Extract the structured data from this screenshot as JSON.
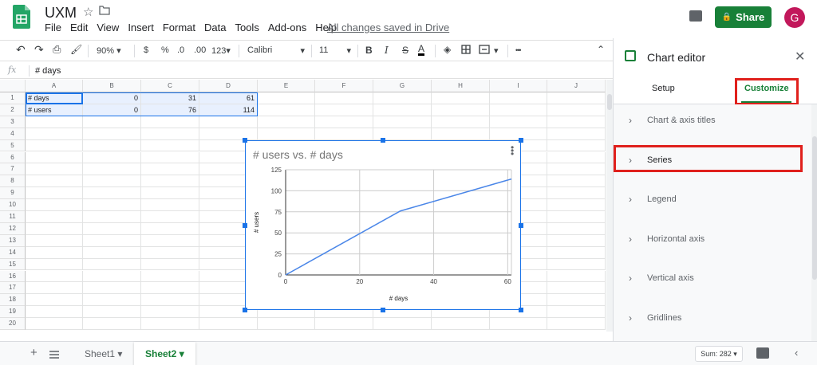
{
  "app": {
    "title": "UXM",
    "saved_status": "All changes saved in Drive",
    "share_label": "Share",
    "avatar_letter": "G",
    "accent_color": "#188038"
  },
  "menu": [
    "File",
    "Edit",
    "View",
    "Insert",
    "Format",
    "Data",
    "Tools",
    "Add-ons",
    "Help"
  ],
  "toolbar": {
    "zoom": "90%",
    "currency": "$",
    "percent": "%",
    "dec_decrease": ".0",
    "dec_increase": ".00",
    "more_formats": "123",
    "font": "Calibri",
    "font_size": "11",
    "bold": "B",
    "italic": "I",
    "strike": "S",
    "text_color": "A",
    "more": "•••"
  },
  "formula": {
    "fx": "fx",
    "value": "# days"
  },
  "grid": {
    "columns": [
      "A",
      "B",
      "C",
      "D",
      "E",
      "F",
      "G",
      "H",
      "I",
      "J"
    ],
    "rows": [
      "1",
      "2",
      "3",
      "4",
      "5",
      "6",
      "7",
      "8",
      "9",
      "10",
      "11",
      "12",
      "13",
      "14",
      "15",
      "16",
      "17",
      "18",
      "19",
      "20"
    ],
    "data": [
      [
        "# days",
        "0",
        "31",
        "61"
      ],
      [
        "# users",
        "0",
        "76",
        "114"
      ]
    ]
  },
  "chart_data": {
    "type": "line",
    "title": "# users vs. # days",
    "xlabel": "# days",
    "ylabel": "# users",
    "x": [
      0,
      31,
      61
    ],
    "series": [
      {
        "values": [
          0,
          76,
          114
        ]
      }
    ],
    "xlim": [
      0,
      61
    ],
    "ylim": [
      0,
      125
    ],
    "xticks": [
      0,
      20,
      40,
      60
    ],
    "yticks": [
      0,
      25,
      50,
      75,
      100,
      125
    ],
    "grid": true,
    "line_color": "#4a86e8"
  },
  "sheets": {
    "tabs": [
      {
        "label": "Sheet1",
        "active": false
      },
      {
        "label": "Sheet2",
        "active": true
      }
    ],
    "sum": "Sum: 282"
  },
  "editor": {
    "title": "Chart editor",
    "tabs": [
      "Setup",
      "Customize"
    ],
    "sections": [
      "Chart & axis titles",
      "Series",
      "Legend",
      "Horizontal axis",
      "Vertical axis",
      "Gridlines"
    ]
  }
}
